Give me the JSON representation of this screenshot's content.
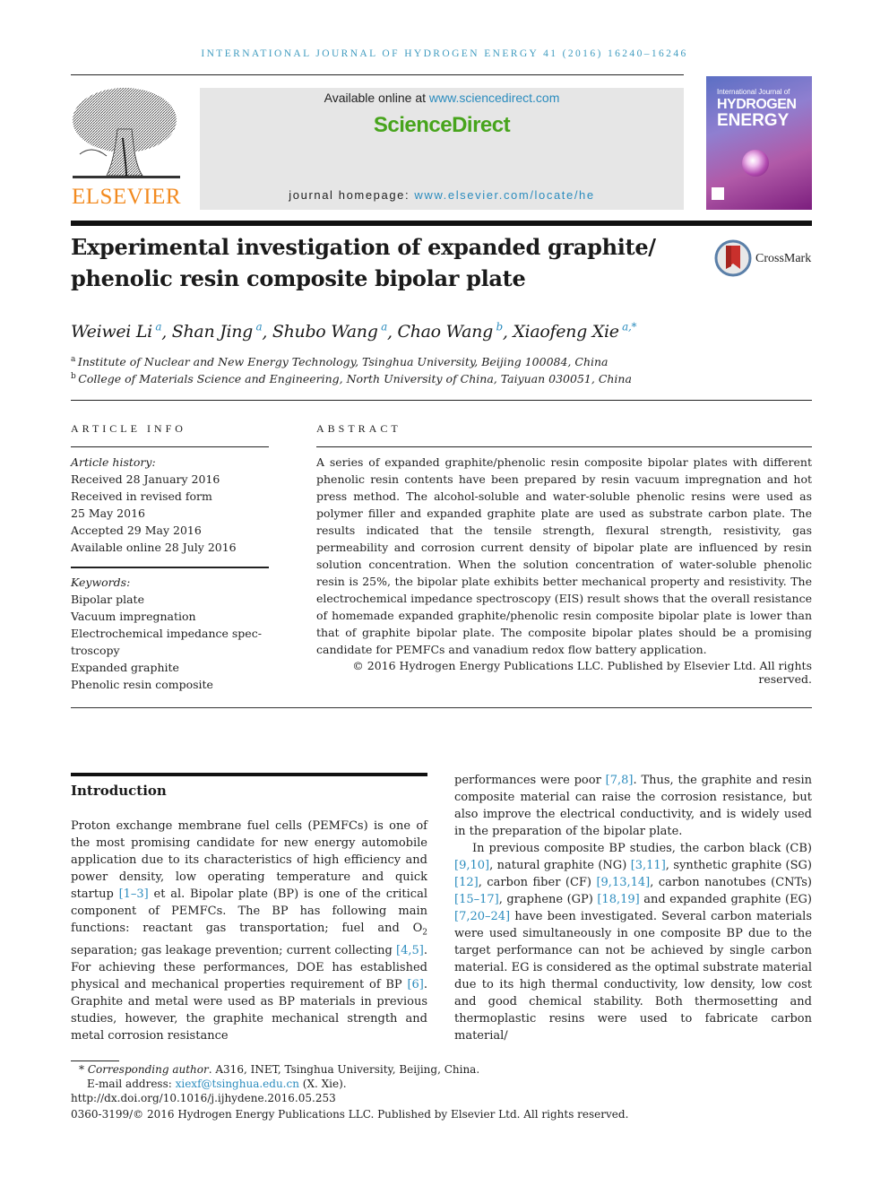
{
  "running_head": "INTERNATIONAL JOURNAL OF HYDROGEN ENERGY 41 (2016) 16240–16246",
  "masthead": {
    "publisher_logo_text": "ELSEVIER",
    "available_online_prefix": "Available online at ",
    "available_online_link": "www.sciencedirect.com",
    "brand": "ScienceDirect",
    "homepage_prefix": "journal homepage: ",
    "homepage_link": "www.elsevier.com/locate/he",
    "cover": {
      "line1": "International Journal of",
      "line2": "HYDROGEN",
      "line3": "ENERGY"
    },
    "colors": {
      "link": "#2b8cbe",
      "brand_green": "#47a41c",
      "elsevier_orange": "#f28a1f",
      "running_head": "#3f9bbf"
    }
  },
  "article": {
    "title_line1": "Experimental investigation of expanded graphite/",
    "title_line2": "phenolic resin composite bipolar plate",
    "crossmark_label": "CrossMark",
    "authors": [
      {
        "name": "Weiwei Li",
        "sup": "a",
        "sep": ", "
      },
      {
        "name": "Shan Jing",
        "sup": "a",
        "sep": ", "
      },
      {
        "name": "Shubo Wang",
        "sup": "a",
        "sep": ", "
      },
      {
        "name": "Chao Wang",
        "sup": "b",
        "sep": ", "
      },
      {
        "name": "Xiaofeng Xie",
        "sup": "a,*",
        "sep": ""
      }
    ],
    "affiliations": [
      {
        "label": "a",
        "text": "Institute of Nuclear and New Energy Technology, Tsinghua University, Beijing 100084, China"
      },
      {
        "label": "b",
        "text": "College of Materials Science and Engineering, North University of China, Taiyuan 030051, China"
      }
    ]
  },
  "article_info": {
    "heading": "ARTICLE INFO",
    "history_label": "Article history:",
    "history": [
      "Received 28 January 2016",
      "Received in revised form",
      "25 May 2016",
      "Accepted 29 May 2016",
      "Available online 28 July 2016"
    ],
    "keywords_label": "Keywords:",
    "keywords": [
      "Bipolar plate",
      "Vacuum impregnation",
      "Electrochemical impedance spec-",
      "troscopy",
      "Expanded graphite",
      "Phenolic resin composite"
    ]
  },
  "abstract": {
    "heading": "ABSTRACT",
    "text": "A series of expanded graphite/phenolic resin composite bipolar plates with different phenolic resin contents have been prepared by resin vacuum impregnation and hot press method. The alcohol-soluble and water-soluble phenolic resins were used as polymer filler and expanded graphite plate are used as substrate carbon plate. The results indicated that the tensile strength, flexural strength, resistivity, gas permeability and corrosion current density of bipolar plate are influenced by resin solution concentration. When the solution concentration of water-soluble phenolic resin is 25%, the bipolar plate exhibits better mechanical property and resistivity. The electrochemical impedance spectroscopy (EIS) result shows that the overall resistance of homemade expanded graphite/phenolic resin composite bipolar plate is lower than that of graphite bipolar plate. The composite bipolar plates should be a promising candidate for PEMFCs and vanadium redox flow battery application.",
    "copyright": "© 2016 Hydrogen Energy Publications LLC. Published by Elsevier Ltd. All rights reserved."
  },
  "introduction": {
    "heading": "Introduction",
    "left": [
      {
        "t": "Proton exchange membrane fuel cells (PEMFCs) is one of the most promising candidate for new energy automobile application due to its characteristics of high efficiency and power density, low operating temperature and quick startup "
      },
      {
        "ref": "[1–3]"
      },
      {
        "t": " et al. Bipolar plate (BP) is one of the critical component of PEMFCs. The BP has following main functions: reactant gas transportation; fuel and O"
      },
      {
        "sub": "2"
      },
      {
        "t": " separation; gas leakage prevention; current collecting "
      },
      {
        "ref": "[4,5]"
      },
      {
        "t": ". For achieving these performances, DOE has established physical and mechanical properties requirement of BP "
      },
      {
        "ref": "[6]"
      },
      {
        "t": ". Graphite and metal were used as BP materials in previous studies, however, the graphite mechanical strength and metal corrosion resistance"
      }
    ],
    "right_p1": [
      {
        "t": "performances were poor "
      },
      {
        "ref": "[7,8]"
      },
      {
        "t": ". Thus, the graphite and resin composite material can raise the corrosion resistance, but also improve the electrical conductivity, and is widely used in the preparation of the bipolar plate."
      }
    ],
    "right_p2": [
      {
        "t": "In previous composite BP studies, the carbon black (CB) "
      },
      {
        "ref": "[9,10]"
      },
      {
        "t": ", natural graphite (NG) "
      },
      {
        "ref": "[3,11]"
      },
      {
        "t": ", synthetic graphite (SG) "
      },
      {
        "ref": "[12]"
      },
      {
        "t": ", carbon fiber (CF) "
      },
      {
        "ref": "[9,13,14]"
      },
      {
        "t": ", carbon nanotubes (CNTs) "
      },
      {
        "ref": "[15–17]"
      },
      {
        "t": ", graphene (GP) "
      },
      {
        "ref": "[18,19]"
      },
      {
        "t": " and expanded graphite (EG) "
      },
      {
        "ref": "[7,20–24]"
      },
      {
        "t": " have been investigated. Several carbon materials were used simultaneously in one composite BP due to the target performance can not be achieved by single carbon material. EG is considered as the optimal substrate material due to its high thermal conductivity, low density, low cost and good chemical stability. Both thermosetting and thermoplastic resins were used to fabricate carbon material/"
      }
    ]
  },
  "footnotes": {
    "corresponding_mark": "*",
    "corresponding_label": "Corresponding author",
    "corresponding_text": ". A316, INET, Tsinghua University, Beijing, China.",
    "email_label": "E-mail address: ",
    "email": "xiexf@tsinghua.edu.cn",
    "email_suffix": " (X. Xie).",
    "doi": "http://dx.doi.org/10.1016/j.ijhydene.2016.05.253",
    "issn_copyright": "0360-3199/© 2016 Hydrogen Energy Publications LLC. Published by Elsevier Ltd. All rights reserved."
  }
}
